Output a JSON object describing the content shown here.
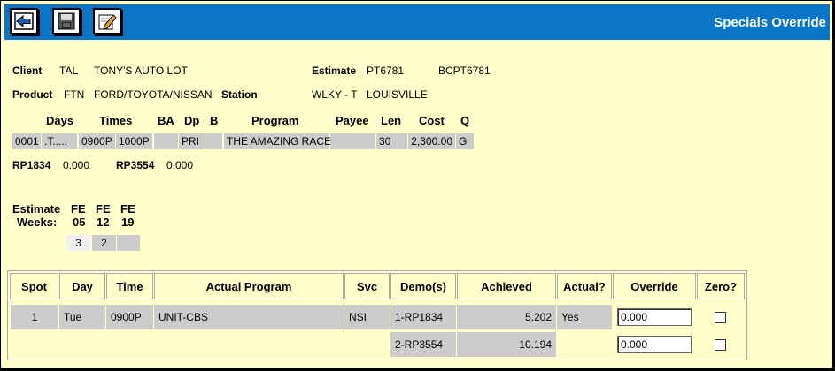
{
  "header": {
    "title": "Specials Override"
  },
  "toolbar": {
    "back_icon": "arrow-left-icon",
    "save_icon": "save-disk-icon",
    "edit_icon": "edit-pencil-icon"
  },
  "info": {
    "client_label": "Client",
    "client_code": "TAL",
    "client_name": "TONY'S AUTO LOT",
    "estimate_label": "Estimate",
    "estimate_code": "PT6781",
    "estimate_alt": "BCPT6781",
    "product_label": "Product",
    "product_code": "FTN",
    "product_name": "FORD/TOYOTA/NISSAN",
    "station_label": "Station",
    "station_code": "WLKY - T",
    "station_city": "LOUISVILLE"
  },
  "buy": {
    "headers": {
      "days": "Days",
      "times": "Times",
      "ba": "BA",
      "dp": "Dp",
      "b": "B",
      "program": "Program",
      "payee": "Payee",
      "len": "Len",
      "cost": "Cost",
      "q": "Q"
    },
    "row": {
      "line": "0001",
      "days": ".T.....",
      "start": "0900P",
      "end": "1000P",
      "ba": "",
      "dp": "PRI",
      "b": "",
      "program": "THE AMAZING RACE",
      "payee": "",
      "len": "30",
      "cost": "2,300.00",
      "q": "G"
    }
  },
  "ratings": {
    "r1_label": "RP1834",
    "r1_value": "0.000",
    "r2_label": "RP3554",
    "r2_value": "0.000"
  },
  "weeks": {
    "label1": "Estimate",
    "label2": "Weeks:",
    "cols": [
      {
        "m": "FE",
        "d": "05",
        "v": "3"
      },
      {
        "m": "FE",
        "d": "12",
        "v": "2"
      },
      {
        "m": "FE",
        "d": "19",
        "v": ""
      }
    ]
  },
  "grid": {
    "headers": {
      "spot": "Spot",
      "day": "Day",
      "time": "Time",
      "program": "Actual Program",
      "svc": "Svc",
      "demos": "Demo(s)",
      "achieved": "Achieved",
      "actual": "Actual?",
      "override": "Override",
      "zero": "Zero?"
    },
    "row1": {
      "spot": "1",
      "day": "Tue",
      "time": "0900P",
      "program": "UNIT-CBS",
      "svc": "NSI",
      "demo": "1-RP1834",
      "achieved": "5.202",
      "actual": "Yes",
      "override": "0.000"
    },
    "row2": {
      "demo": "2-RP3554",
      "achieved": "10.194",
      "override": "0.000"
    }
  }
}
